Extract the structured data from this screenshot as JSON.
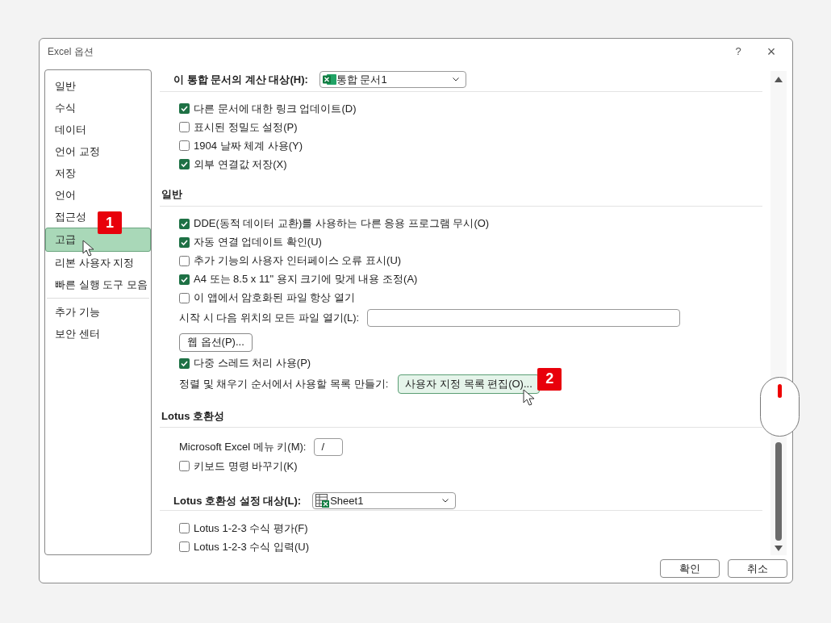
{
  "window": {
    "title": "Excel 옵션",
    "help": "?",
    "close": "×"
  },
  "sidebar": {
    "groups": [
      [
        {
          "label": "일반",
          "selected": false
        },
        {
          "label": "수식",
          "selected": false
        },
        {
          "label": "데이터",
          "selected": false
        },
        {
          "label": "언어 교정",
          "selected": false
        },
        {
          "label": "저장",
          "selected": false
        },
        {
          "label": "언어",
          "selected": false
        },
        {
          "label": "접근성",
          "selected": false
        },
        {
          "label": "고급",
          "selected": true,
          "badge": "1"
        },
        {
          "label": "리본 사용자 지정",
          "selected": false
        },
        {
          "label": "빠른 실행 도구 모음",
          "selected": false
        }
      ],
      [
        {
          "label": "추가 기능",
          "selected": false
        },
        {
          "label": "보안 센터",
          "selected": false
        }
      ]
    ]
  },
  "sections": [
    {
      "title": "이 통합 문서의 계산 대상(H):",
      "dropdown": {
        "value": "통합 문서1",
        "kind": "workbook"
      },
      "rows": [
        {
          "kind": "checkbox",
          "label": "다른 문서에 대한 링크 업데이트(D)",
          "checked": true
        },
        {
          "kind": "checkbox",
          "label": "표시된 정밀도 설정(P)",
          "checked": false
        },
        {
          "kind": "checkbox",
          "label": "1904 날짜 체계 사용(Y)",
          "checked": false
        },
        {
          "kind": "checkbox",
          "label": "외부 연결값 저장(X)",
          "checked": true
        }
      ]
    },
    {
      "title": "일반",
      "rows": [
        {
          "kind": "checkbox",
          "label": "DDE(동적 데이터 교환)를 사용하는 다른 응용 프로그램 무시(O)",
          "checked": true
        },
        {
          "kind": "checkbox",
          "label": "자동 연결 업데이트 확인(U)",
          "checked": true
        },
        {
          "kind": "checkbox",
          "label": "추가 기능의 사용자 인터페이스 오류 표시(U)",
          "checked": false
        },
        {
          "kind": "checkbox",
          "label": "A4 또는 8.5 x 11\" 용지 크기에 맞게 내용 조정(A)",
          "checked": true
        },
        {
          "kind": "checkbox",
          "label": "이 앱에서 암호화된 파일 항상 열기",
          "checked": false
        },
        {
          "kind": "field",
          "label": "시작 시 다음 위치의 모든 파일 열기(L):"
        },
        {
          "kind": "button",
          "label": "웹 옵션(P)..."
        },
        {
          "kind": "checkbox",
          "label": "다중 스레드 처리 사용(P)",
          "checked": true
        },
        {
          "kind": "label_button",
          "label": "정렬 및 채우기 순서에서 사용할 목록 만들기:",
          "button": "사용자 지정 목록 편집(O)...",
          "badge": "2"
        }
      ]
    },
    {
      "title": "Lotus 호환성",
      "rows": [
        {
          "kind": "field",
          "label": "Microsoft Excel 메뉴 키(M):",
          "value": "/"
        },
        {
          "kind": "checkbox",
          "label": "키보드 명령 바꾸기(K)",
          "checked": false
        }
      ]
    },
    {
      "title": "Lotus 호환성 설정 대상(L):",
      "dropdown": {
        "value": "Sheet1",
        "kind": "sheet"
      },
      "rows": [
        {
          "kind": "checkbox",
          "label": "Lotus 1-2-3 수식 평가(F)",
          "checked": false
        },
        {
          "kind": "checkbox",
          "label": "Lotus 1-2-3 수식 입력(U)",
          "checked": false
        }
      ]
    }
  ],
  "buttons": [
    "확인",
    "취소"
  ]
}
